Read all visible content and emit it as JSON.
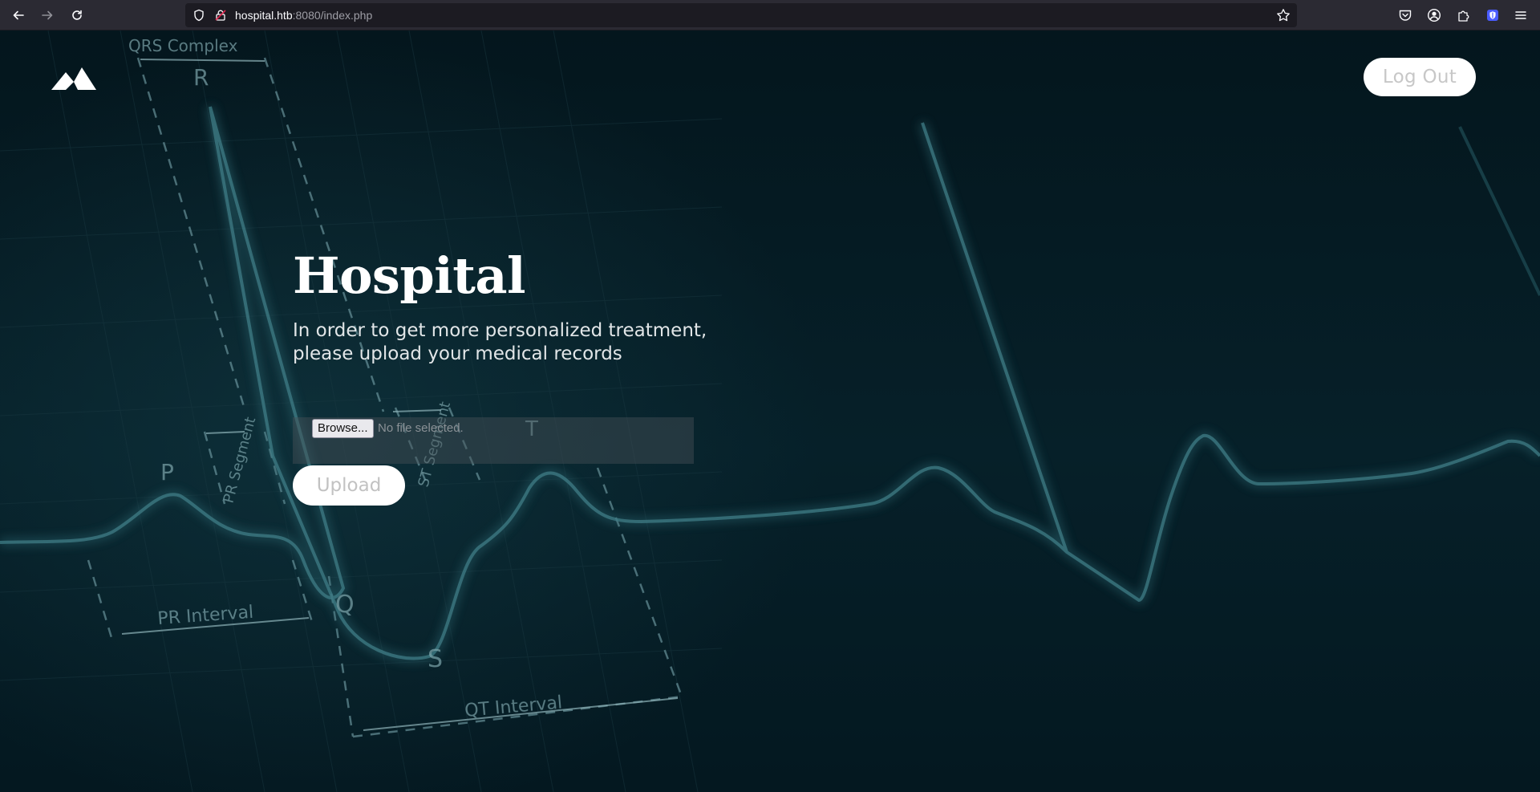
{
  "browser": {
    "url_host": "hospital.htb",
    "url_rest": ":8080/index.php",
    "icons": [
      "back-icon",
      "forward-icon",
      "reload-icon",
      "shield-icon",
      "lock-icon",
      "star-icon",
      "pocket-icon",
      "account-icon",
      "extensions-icon",
      "extension-icon",
      "menu-icon"
    ]
  },
  "header": {
    "logo": "mountain-icon",
    "logout_label": "Log Out"
  },
  "hero": {
    "title": "Hospital",
    "subtitle": "In order to get more personalized treatment, please upload your medical records"
  },
  "upload_form": {
    "browse_label": "Browse...",
    "file_status": "No file selected.",
    "upload_label": "Upload"
  },
  "background_labels": {
    "qrs": "QRS Complex",
    "r": "R",
    "p": "P",
    "q": "Q",
    "s": "S",
    "t": "T",
    "pr_segment": "PR Segment",
    "st_segment": "ST Segment",
    "pr_interval": "PR Interval",
    "qt_interval": "QT Interval"
  },
  "colors": {
    "page_bg": "#041820",
    "ecg_line": "#3f7c86",
    "chrome_bg": "#2b2a33"
  }
}
